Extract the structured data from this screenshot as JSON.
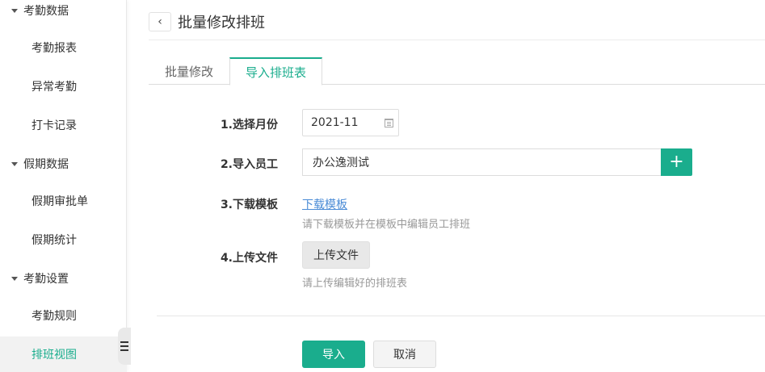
{
  "sidebar": {
    "groups": [
      {
        "label": "考勤数据"
      },
      {
        "label": "假期数据"
      },
      {
        "label": "考勤设置"
      }
    ],
    "items": [
      {
        "label": "考勤报表"
      },
      {
        "label": "异常考勤"
      },
      {
        "label": "打卡记录"
      },
      {
        "label": "假期审批单"
      },
      {
        "label": "假期统计"
      },
      {
        "label": "考勤规则"
      },
      {
        "label": "排班视图",
        "active": true
      }
    ]
  },
  "header": {
    "back_icon": "chevron-left-icon",
    "title": "批量修改排班"
  },
  "tabs": [
    {
      "label": "批量修改"
    },
    {
      "label": "导入排班表",
      "active": true
    }
  ],
  "form": {
    "month": {
      "label": "1.选择月份",
      "value": "2021-11",
      "icon": "calendar-icon"
    },
    "employee": {
      "label": "2.导入员工",
      "value": "办公逸测试",
      "add_label": "+"
    },
    "template": {
      "label": "3.下载模板",
      "link": "下载模板",
      "hint": "请下载模板并在模板中编辑员工排班"
    },
    "upload": {
      "label": "4.上传文件",
      "button": "上传文件",
      "hint": "请上传编辑好的排班表"
    }
  },
  "actions": {
    "import": "导入",
    "cancel": "取消"
  },
  "colors": {
    "accent": "#1aad8d",
    "link": "#4a8bd6"
  }
}
